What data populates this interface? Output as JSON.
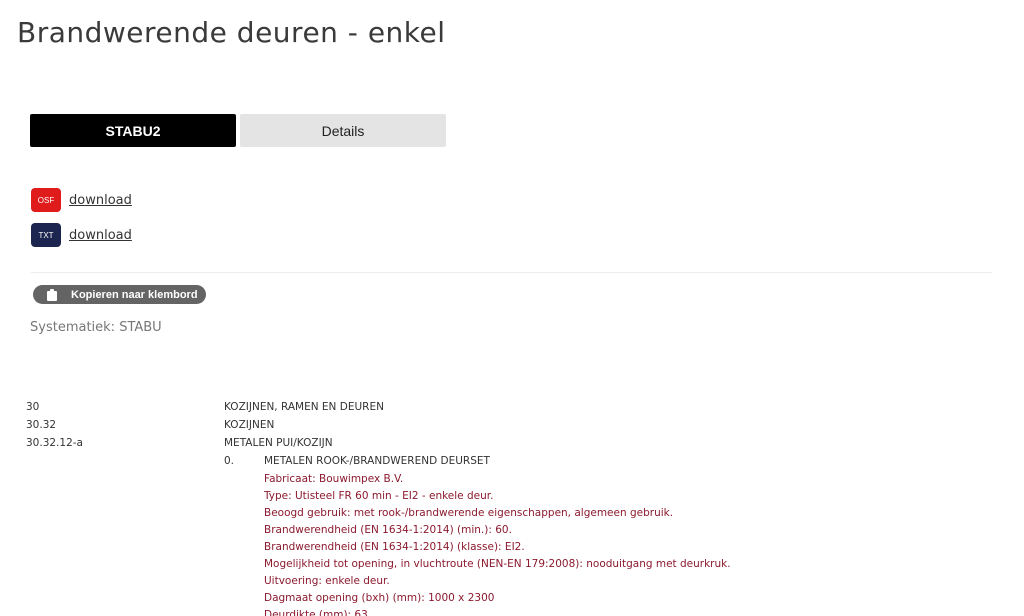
{
  "page": {
    "title": "Brandwerende deuren - enkel"
  },
  "tabs": [
    {
      "label": "STABU2",
      "active": true
    },
    {
      "label": "Details",
      "active": false
    }
  ],
  "downloads": [
    {
      "badge": "OSF",
      "label": "download",
      "color": "#e01b1b"
    },
    {
      "badge": "TXT",
      "label": "download",
      "color": "#1c2450"
    }
  ],
  "copy_button": {
    "label": "Kopieren naar klembord",
    "icon": "clipboard-icon"
  },
  "systematiek": "Systematiek: STABU",
  "spec": {
    "rows": [
      {
        "code": "30",
        "title": "KOZIJNEN, RAMEN EN DEUREN"
      },
      {
        "code": "30.32",
        "title": "KOZIJNEN"
      },
      {
        "code": "30.32.12-a",
        "title": "METALEN PUI/KOZIJN"
      }
    ],
    "sub": {
      "num": "0.",
      "title": "METALEN ROOK-/BRANDWEREND DEURSET"
    },
    "properties": [
      "Fabricaat: Bouwimpex B.V.",
      "Type: Utisteel FR 60 min - EI2 - enkele deur.",
      "Beoogd gebruik: met rook-/brandwerende eigenschappen, algemeen gebruik.",
      "Brandwerendheid (EN 1634-1:2014) (min.): 60.",
      "Brandwerendheid (EN 1634-1:2014) (klasse): EI2.",
      "Mogelijkheid tot opening, in vluchtroute (NEN-EN 179:2008): nooduitgang met deurkruk.",
      "Uitvoering: enkele deur.",
      "Dagmaat opening (bxh) (mm): 1000 x 2300",
      "Deurdikte (mm): 63"
    ],
    "property_color": "#8b1a2e"
  }
}
